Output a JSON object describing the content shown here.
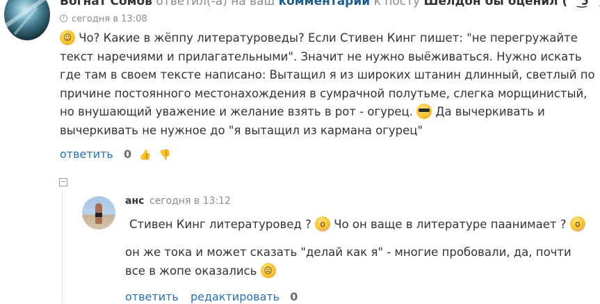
{
  "comment1": {
    "author": "Богнат Сомов",
    "replied_text": "ответил(-а) на ваш",
    "replied_link": "комментарий",
    "post_prefix": "к посту",
    "post_title": "Шелдон бы оценил ( ͡° ͜ʖ ͡°)",
    "time": "сегодня в 13:08",
    "text_part1": "Чо? Какие в жёппу литературоведы? Если Стивен Кинг пишет: \"не перегружайте текст наречиями и прилагательными\". Значит не нужно выёживаться. Нужно искать где там в своем тексте написано: Вытащил я из широких штанин длинный, светлый по причине постоянного местонахождения в сумрачной полутьме, слегка морщинистый, но внушающий уважение и желание взять в рот - огурец.",
    "text_part2": "Да вычеркивать и вычеркивать не нужное до \"я вытащил из кармана огурец\"",
    "reply_label": "ответить",
    "rating": "0"
  },
  "comment2": {
    "author": "анс",
    "time": "сегодня в 13:12",
    "line1_part1": "Стивен Кинг  литературовед ?",
    "line1_part2": "Чо он ваще в литературе паанимает ?",
    "line2": "он же тока и может сказать \"делай как я\" - многие пробовали, да, почти все в жопе оказались",
    "reply_label": "ответить",
    "edit_label": "редактировать",
    "rating": "0"
  },
  "icons": {
    "collapse": "−"
  }
}
